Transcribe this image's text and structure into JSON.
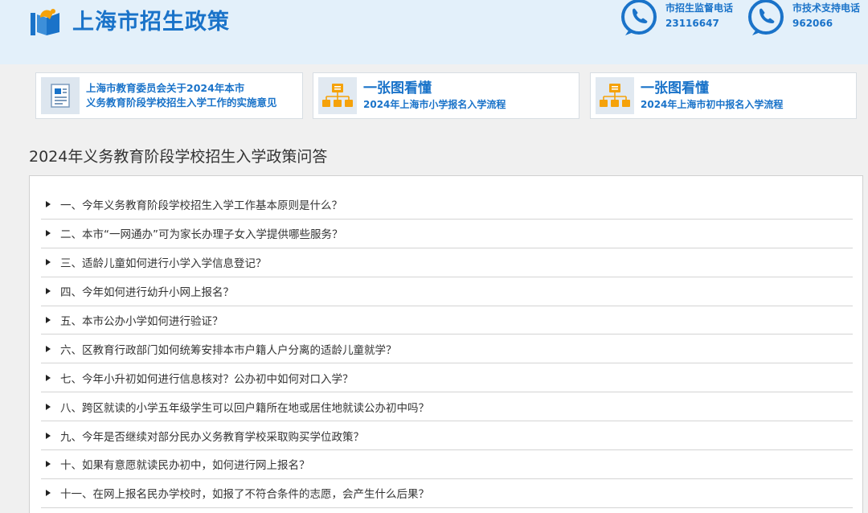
{
  "header": {
    "site_title": "上海市招生政策",
    "hotlines": [
      {
        "label": "市招生监督电话",
        "number": "23116647"
      },
      {
        "label": "市技术支持电话",
        "number": "962066"
      }
    ]
  },
  "cards": [
    {
      "lines": [
        "上海市教育委员会关于2024年本市",
        "义务教育阶段学校招生入学工作的实施意见"
      ]
    },
    {
      "title": "一张图看懂",
      "subtitle": "2024年上海市小学报名入学流程"
    },
    {
      "title": "一张图看懂",
      "subtitle": "2024年上海市初中报名入学流程"
    }
  ],
  "section_title": "2024年义务教育阶段学校招生入学政策问答",
  "questions": [
    "一、今年义务教育阶段学校招生入学工作基本原则是什么？",
    "二、本市“一网通办”可为家长办理子女入学提供哪些服务？",
    "三、适龄儿童如何进行小学入学信息登记？",
    "四、今年如何进行幼升小网上报名？",
    "五、本市公办小学如何进行验证？",
    "六、区教育行政部门如何统筹安排本市户籍人户分离的适龄儿童就学？",
    "七、今年小升初如何进行信息核对？公办初中如何对口入学？",
    "八、跨区就读的小学五年级学生可以回户籍所在地或居住地就读公办初中吗？",
    "九、今年是否继续对部分民办义务教育学校采取购买学位政策？",
    "十、如果有意愿就读民办初中，如何进行网上报名？",
    "十一、在网上报名民办学校时，如报了不符合条件的志愿，会产生什么后果？"
  ],
  "colors": {
    "accent": "#1a73c9",
    "header_bg": "#e3f0fa",
    "icon_orange": "#f5a20a"
  }
}
